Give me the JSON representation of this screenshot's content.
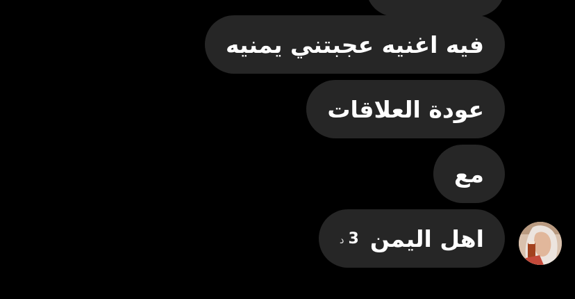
{
  "messages": [
    {
      "text": ""
    },
    {
      "text": "فيه اغنيه عجبتني يمنيه"
    },
    {
      "text": "عودة العلاقات"
    },
    {
      "text": "مع"
    },
    {
      "text": "اهل اليمن",
      "reaction_count": "3",
      "reaction_unit": "د"
    }
  ],
  "sender": {
    "avatar_icon": "user-avatar-icon"
  },
  "colors": {
    "background": "#000000",
    "bubble": "#262626",
    "text": "#ffffff"
  }
}
